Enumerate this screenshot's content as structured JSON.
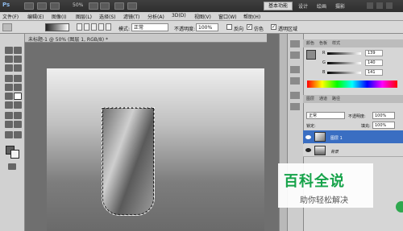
{
  "appbar": {
    "logo": "Ps",
    "zoom": "50%",
    "workspace_active": "基本功能",
    "workspaces": [
      "设计",
      "绘画",
      "摄影"
    ]
  },
  "menu": [
    "文件(F)",
    "编辑(E)",
    "图像(I)",
    "图层(L)",
    "选择(S)",
    "滤镜(T)",
    "分析(A)",
    "3D(D)",
    "视图(V)",
    "窗口(W)",
    "帮助(H)"
  ],
  "options": {
    "mode_label": "模式:",
    "mode_value": "正常",
    "opacity_label": "不透明度:",
    "opacity_value": "100%",
    "reverse_label": "反向",
    "dither_label": "仿色",
    "transparency_label": "透明区域",
    "dither_checked": "✓",
    "transparency_checked": "✓"
  },
  "document": {
    "tab_title": "未标题-1 @ 50% (图层 1, RGB/8) *"
  },
  "color_panel": {
    "tabs": [
      "颜色",
      "色板",
      "样式"
    ],
    "r_label": "R",
    "g_label": "G",
    "b_label": "B",
    "r": "139",
    "g": "140",
    "b": "141"
  },
  "layers_panel": {
    "tabs": [
      "图层",
      "通道",
      "路径"
    ],
    "blend_mode": "正常",
    "opacity_label": "不透明度:",
    "opacity": "100%",
    "lock_label": "锁定:",
    "fill_label": "填充:",
    "fill": "100%",
    "layers": [
      "图层 1",
      "背景"
    ]
  },
  "watermark": {
    "title": "百科全说",
    "subtitle": "助你轻松解决"
  }
}
